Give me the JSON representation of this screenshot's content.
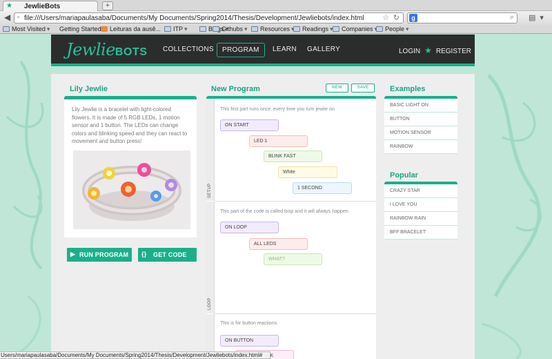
{
  "browser": {
    "tab_title": "JewlieBots",
    "new_tab": "+",
    "url": "file:///Users/mariapaulasaba/Documents/My Documents/Spring2014/Thesis/Development/Jewliebots/index.html",
    "search_engine_letter": "g",
    "bookmarks": [
      {
        "label": "Most Visited",
        "icon": "folder",
        "caret": "▾"
      },
      {
        "label": "Getting Started",
        "icon": "none",
        "caret": ""
      },
      {
        "label": "Leituras da ausê...",
        "icon": "blog",
        "caret": ""
      },
      {
        "label": "ITP",
        "icon": "folder",
        "caret": "▾"
      },
      {
        "label": "Blogs",
        "icon": "folder",
        "caret": "▾"
      },
      {
        "label": "Githubs",
        "icon": "folder",
        "caret": "▾"
      },
      {
        "label": "Resources",
        "icon": "folder",
        "caret": "▾"
      },
      {
        "label": "Readings",
        "icon": "folder",
        "caret": "▾"
      },
      {
        "label": "Companies",
        "icon": "folder",
        "caret": "▾"
      },
      {
        "label": "People",
        "icon": "folder",
        "caret": "▾"
      }
    ],
    "status_text": "Users/mariapaulasaba/Documents/My Documents/Spring2014/Thesis/Development/Jewliebots/index.html#"
  },
  "site": {
    "logo_script": "Jewlie",
    "logo_bold": "BOTS",
    "nav": [
      "COLLECTIONS",
      "PROGRAM",
      "LEARN",
      "GALLERY"
    ],
    "active_nav": "PROGRAM",
    "login": "LOGIN",
    "register": "REGISTER"
  },
  "left": {
    "title": "Lily Jewlie",
    "description": "Lily Jewlie is a bracelet with light-colored flowers. It is made of 5 RGB LEDs, 1 motion sensor and 1 button. The LEDs can change colors and blinking speed and they can react to movement and button press!",
    "run_program": "RUN PROGRAM",
    "get_code": "GET CODE"
  },
  "program": {
    "title": "New Program",
    "new_button": "NEW",
    "save_button": "SAVE",
    "setup_label": "SETUP",
    "loop_label": "LOOP",
    "setup_desc": "This first part runs once, every time you turn jewlie on.",
    "loop_desc": "This part of the code is called loop and it will always happen.",
    "button_desc": "This is for button reactions.",
    "setup_blocks": [
      "ON START",
      "LED 1",
      "BLINK FAST",
      "White",
      "1 SECOND"
    ],
    "loop_blocks": [
      "ON LOOP",
      "ALL LEDS",
      "WHAT?"
    ],
    "button_blocks": [
      "ON BUTTON",
      "SINGLE CLICK"
    ]
  },
  "examples": {
    "title": "Examples",
    "items": [
      "BASIC LIGHT ON",
      "BUTTON",
      "MOTION SENSOR",
      "RAINBOW"
    ]
  },
  "popular": {
    "title": "Popular",
    "items": [
      "CRAZY STAR",
      "I LOVE YOU",
      "RAINBOW RAIN",
      "BFF BRACELET"
    ]
  },
  "colors": {
    "brand_green": "#19b08a",
    "header_dark": "#2b2d2d",
    "background_mint": "#bfe6d7"
  }
}
